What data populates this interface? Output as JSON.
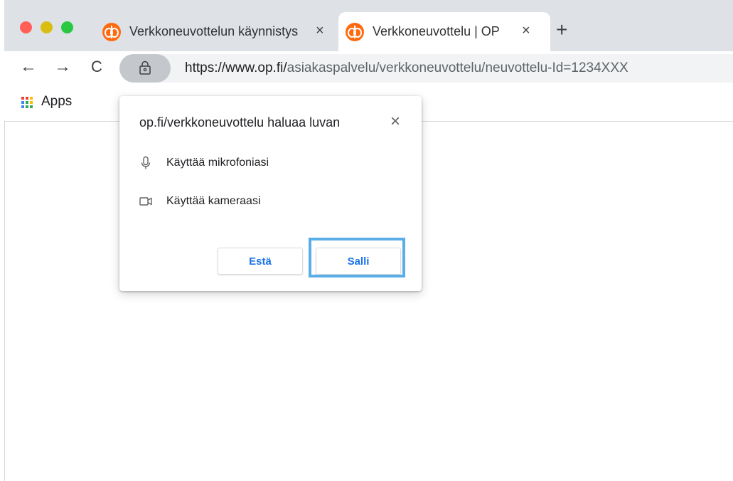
{
  "tabs": [
    {
      "title": "Verkkoneuvottelun käynnistys",
      "close": "×",
      "active": false
    },
    {
      "title": "Verkkoneuvottelu | OP",
      "close": "×",
      "active": true
    }
  ],
  "new_tab": "+",
  "toolbar": {
    "back": "←",
    "forward": "→",
    "reload": "C",
    "url_host": "https://www.op.fi/",
    "url_path": "asiakaspalvelu/verkkoneuvottelu/neuvottelu-Id=1234XXX"
  },
  "bookmarks": {
    "apps_label": "Apps"
  },
  "dialog": {
    "title": "op.fi/verkkoneuvottelu haluaa luvan",
    "close": "×",
    "permissions": [
      {
        "icon": "microphone-icon",
        "label": "Käyttää mikrofoniasi"
      },
      {
        "icon": "camera-icon",
        "label": "Käyttää kameraasi"
      }
    ],
    "block_label": "Estä",
    "allow_label": "Salli"
  },
  "colors": {
    "brand_orange": "#ff6a10",
    "button_text": "#1a73e8",
    "highlight": "#5aaee8",
    "tabstrip": "#dee1e6"
  }
}
